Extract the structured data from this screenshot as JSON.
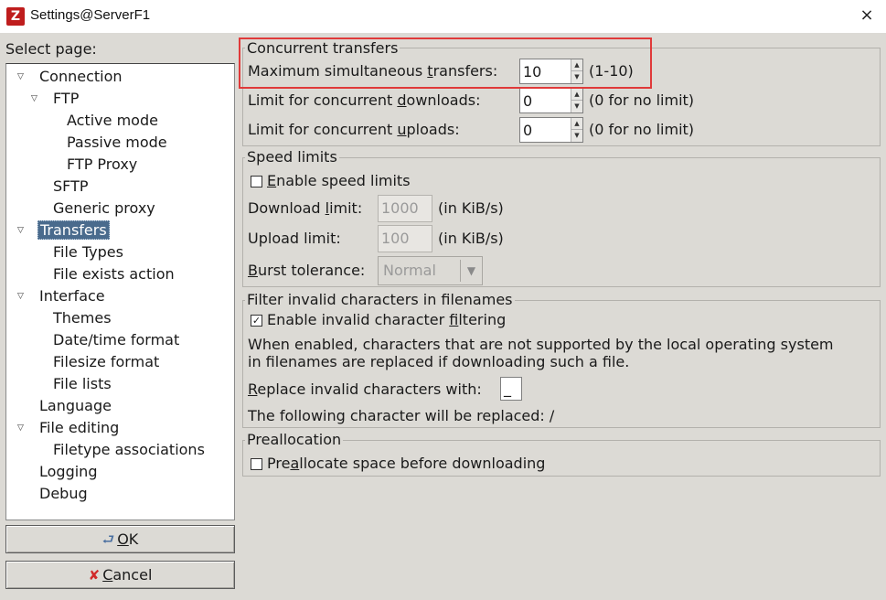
{
  "window": {
    "title": "Settings@ServerF1",
    "app_icon": "filezilla-icon",
    "close_glyph": "×"
  },
  "sidebar": {
    "label": "Select page:",
    "items": [
      {
        "label": "Connection",
        "level": 0,
        "expanded": true
      },
      {
        "label": "FTP",
        "level": 1,
        "expanded": true
      },
      {
        "label": "Active mode",
        "level": 2
      },
      {
        "label": "Passive mode",
        "level": 2
      },
      {
        "label": "FTP Proxy",
        "level": 2
      },
      {
        "label": "SFTP",
        "level": 1
      },
      {
        "label": "Generic proxy",
        "level": 1
      },
      {
        "label": "Transfers",
        "level": 0,
        "expanded": true,
        "selected": true
      },
      {
        "label": "File Types",
        "level": 1
      },
      {
        "label": "File exists action",
        "level": 1
      },
      {
        "label": "Interface",
        "level": 0,
        "expanded": true
      },
      {
        "label": "Themes",
        "level": 1
      },
      {
        "label": "Date/time format",
        "level": 1
      },
      {
        "label": "Filesize format",
        "level": 1
      },
      {
        "label": "File lists",
        "level": 1
      },
      {
        "label": "Language",
        "level": 0
      },
      {
        "label": "File editing",
        "level": 0,
        "expanded": true
      },
      {
        "label": "Filetype associations",
        "level": 1
      },
      {
        "label": "Logging",
        "level": 0
      },
      {
        "label": "Debug",
        "level": 0
      }
    ]
  },
  "buttons": {
    "ok_pre": "",
    "ok_ul": "O",
    "ok_post": "K",
    "cancel_pre": "",
    "cancel_ul": "C",
    "cancel_post": "ancel"
  },
  "concurrent": {
    "title": "Concurrent transfers",
    "max_pre": "Maximum simultaneous ",
    "max_ul": "t",
    "max_post": "ransfers:",
    "max_value": "10",
    "max_hint": "(1-10)",
    "dl_pre": "Limit for concurrent ",
    "dl_ul": "d",
    "dl_post": "ownloads:",
    "dl_value": "0",
    "dl_hint": "(0 for no limit)",
    "ul_pre": "Limit for concurrent ",
    "ul_ul": "u",
    "ul_post": "ploads:",
    "ul_value": "0",
    "ul_hint": "(0 for no limit)"
  },
  "speed": {
    "title": "Speed limits",
    "enable_pre": "",
    "enable_ul": "E",
    "enable_post": "nable speed limits",
    "enable_checked": false,
    "download_pre": "Download ",
    "download_ul": "l",
    "download_post": "imit:",
    "download_value": "1000",
    "download_unit": "(in KiB/s)",
    "upload_label": "Upload limit:",
    "upload_value": "100",
    "upload_unit": "(in KiB/s)",
    "burst_pre": "",
    "burst_ul": "B",
    "burst_post": "urst tolerance:",
    "burst_value": "Normal"
  },
  "filter": {
    "title": "Filter invalid characters in filenames",
    "enable_pre": "Enable invalid character ",
    "enable_ul": "f",
    "enable_post": "iltering",
    "enable_checked": true,
    "description_line1": "When enabled, characters that are not supported by the local operating system",
    "description_line2": "in filenames are replaced if downloading such a file.",
    "replace_pre": "",
    "replace_ul": "R",
    "replace_post": "eplace invalid characters with:",
    "replace_value": "_",
    "following": "The following character will be replaced: /"
  },
  "prealloc": {
    "title": "Preallocation",
    "check_pre": "Pre",
    "check_ul": "a",
    "check_post": "llocate space before downloading",
    "checked": false
  },
  "colors": {
    "selection": "#4a6b8d",
    "highlight_box": "#e03a3a",
    "dialog_bg": "#dcdad5"
  }
}
